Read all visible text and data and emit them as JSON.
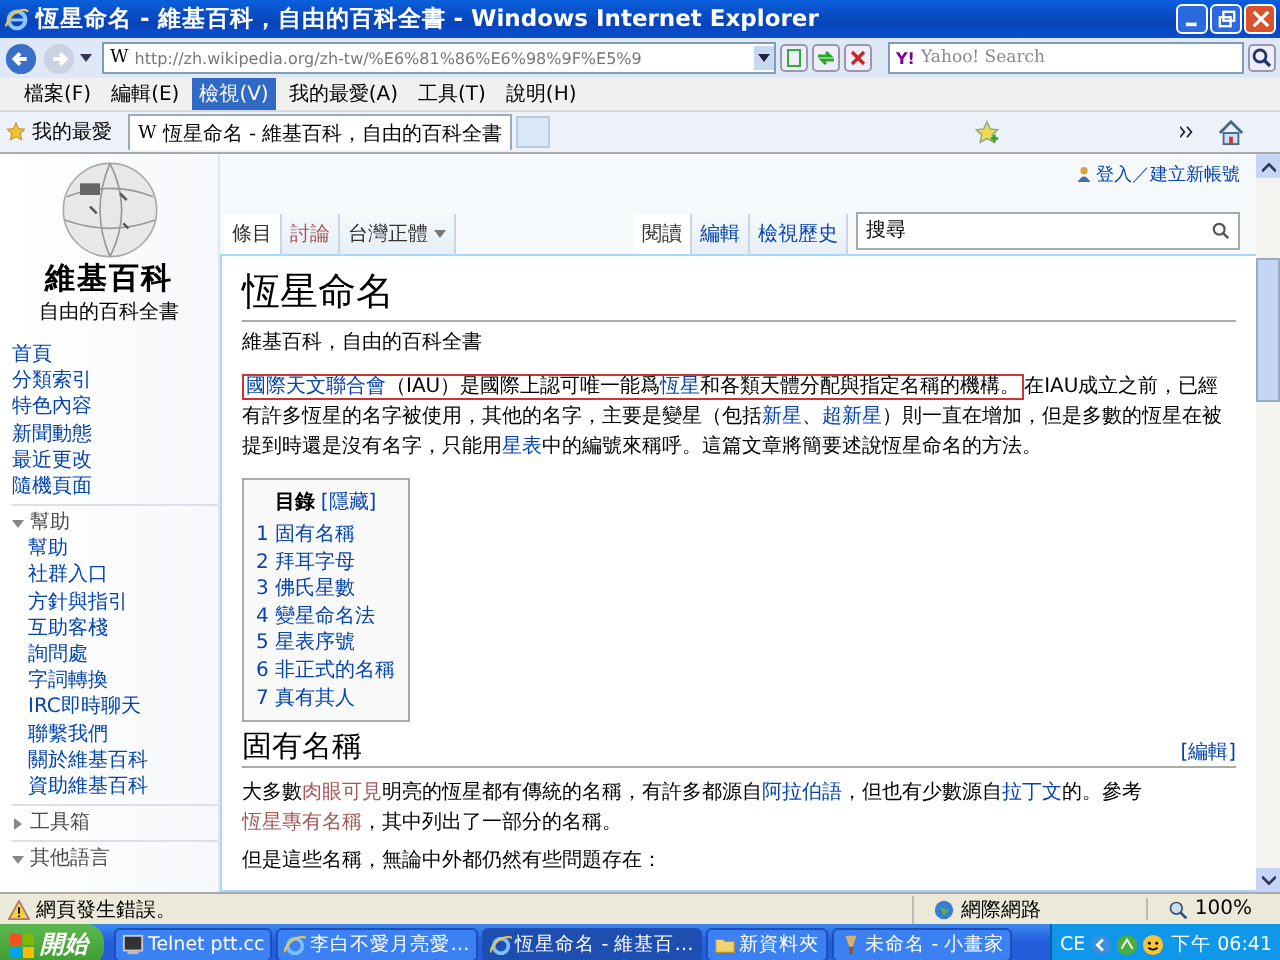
{
  "window": {
    "title": "恆星命名 - 維基百科，自由的百科全書 - Windows Internet Explorer"
  },
  "favicon": "W",
  "address": {
    "provider": "Y!",
    "url": "http://zh.wikipedia.org/zh-tw/%E6%81%86%E6%98%9F%E5%9",
    "search_placeholder": "Yahoo! Search"
  },
  "menu": [
    {
      "label": "檔案(F)",
      "selected": false
    },
    {
      "label": "編輯(E)",
      "selected": false
    },
    {
      "label": "檢視(V)",
      "selected": true
    },
    {
      "label": "我的最愛(A)",
      "selected": false
    },
    {
      "label": "工具(T)",
      "selected": false
    },
    {
      "label": "說明(H)",
      "selected": false
    }
  ],
  "favorites_bar": {
    "label": "我的最愛",
    "favicon": "W",
    "tab_title": "恆星命名 - 維基百科，自由的百科全書"
  },
  "wiki": {
    "user_links": "登入／建立新帳號",
    "logo_title": "維基百科",
    "logo_subtitle": "自由的百科全書",
    "nav": [
      "首頁",
      "分類索引",
      "特色內容",
      "新聞動態",
      "最近更改",
      "隨機頁面"
    ],
    "portals": [
      {
        "label": "幫助",
        "expanded": true,
        "items": [
          "幫助",
          "社群入口",
          "方針與指引",
          "互助客棧",
          "詢問處",
          "字詞轉換",
          "IRC即時聊天",
          "聯繫我們",
          "關於維基百科",
          "資助維基百科"
        ]
      },
      {
        "label": "工具箱",
        "expanded": false
      },
      {
        "label": "其他語言",
        "expanded": true
      }
    ],
    "left_tabs": [
      {
        "label": "條目",
        "selected": true,
        "kind": "link"
      },
      {
        "label": "討論",
        "selected": false,
        "kind": "visited"
      }
    ],
    "variant": "台灣正體",
    "right_tabs": [
      {
        "label": "閱讀",
        "selected": true
      },
      {
        "label": "編輯",
        "selected": false
      },
      {
        "label": "檢視歷史",
        "selected": false
      }
    ],
    "search_placeholder": "搜尋",
    "title": "恆星命名",
    "tagline": "維基百科，自由的百科全書",
    "intro": {
      "highlight": [
        {
          "text": "國際天文聯合會",
          "kind": "link"
        },
        {
          "text": "（IAU）是國際上認可唯一能爲",
          "kind": "text"
        },
        {
          "text": "恆星",
          "kind": "link"
        },
        {
          "text": "和各類天體分配與指定名稱的機構。",
          "kind": "text"
        }
      ],
      "segments": [
        {
          "text": "在IAU成立之前，已經有許多恆星的名字被使用，其他的名字，主要是變星（包括",
          "kind": "text"
        },
        {
          "text": "新星",
          "kind": "link"
        },
        {
          "text": "、",
          "kind": "text"
        },
        {
          "text": "超新星",
          "kind": "link"
        },
        {
          "text": "）則一直在增加，但是多數的恆星在被提到時還是沒有名字，只能用",
          "kind": "text"
        },
        {
          "text": "星表",
          "kind": "link"
        },
        {
          "text": "中的編號來稱呼。這篇文章將簡要述說恆星命名的方法。",
          "kind": "text"
        }
      ]
    },
    "toc": {
      "title": "目錄",
      "toggle": "[隱藏]",
      "items": [
        {
          "number": "1",
          "label": "固有名稱"
        },
        {
          "number": "2",
          "label": "拜耳字母"
        },
        {
          "number": "3",
          "label": "佛氏星數"
        },
        {
          "number": "4",
          "label": "變星命名法"
        },
        {
          "number": "5",
          "label": "星表序號"
        },
        {
          "number": "6",
          "label": "非正式的名稱"
        },
        {
          "number": "7",
          "label": "真有其人"
        }
      ]
    },
    "section": {
      "heading": "固有名稱",
      "edit": "[編輯]",
      "paragraphs": [
        {
          "segments": [
            {
              "text": "大多數",
              "kind": "text"
            },
            {
              "text": "肉眼可見",
              "kind": "visited"
            },
            {
              "text": "明亮的恆星都有傳統的名稱，有許多都源自",
              "kind": "text"
            },
            {
              "text": "阿拉伯語",
              "kind": "link"
            },
            {
              "text": "，但也有少數源自",
              "kind": "text"
            },
            {
              "text": "拉丁文",
              "kind": "link"
            },
            {
              "text": "的。參考",
              "kind": "text"
            },
            {
              "text": "恆星專有名稱",
              "kind": "visited"
            },
            {
              "text": "，其中列出了一部分的名稱。",
              "kind": "text"
            }
          ]
        },
        {
          "segments": [
            {
              "text": "但是這些名稱，無論中外都仍然有些問題存在：",
              "kind": "text"
            }
          ]
        }
      ]
    }
  },
  "status_bar": {
    "message": "網頁發生錯誤。",
    "zone": "網際網路",
    "zoom": "100%"
  },
  "taskbar": {
    "start": "開始",
    "tasks": [
      {
        "label": "Telnet ptt.cc",
        "selected": false,
        "kind": "terminal"
      },
      {
        "label": "李白不愛月亮愛…",
        "selected": false,
        "kind": "browser"
      },
      {
        "label": "恆星命名 - 維基百…",
        "selected": true,
        "kind": "browser"
      },
      {
        "label": "新資料夾",
        "selected": false,
        "kind": "folder"
      },
      {
        "label": "未命名 - 小畫家",
        "selected": false,
        "kind": "paint"
      }
    ],
    "language": "CE",
    "clock": "下午 06:41"
  }
}
